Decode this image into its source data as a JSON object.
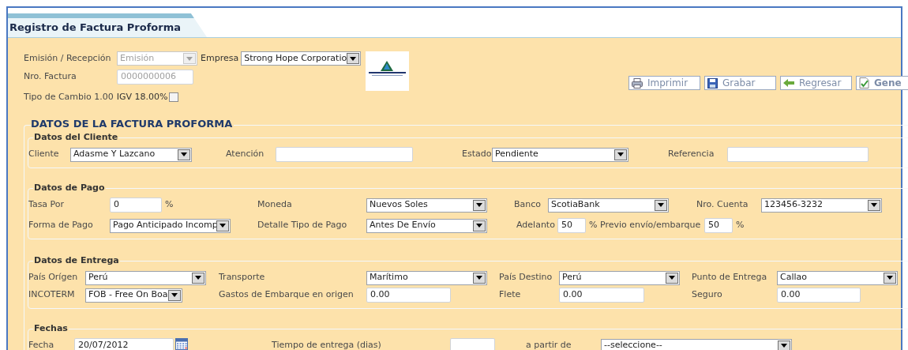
{
  "tab": {
    "title": "Registro de Factura Proforma"
  },
  "header": {
    "emision": {
      "label": "Emisión / Recepción",
      "value": "Emisión",
      "disabled": true
    },
    "empresa": {
      "label": "Empresa",
      "value": "Strong Hope Corporatio",
      "disabled": false
    },
    "nro_factura": {
      "label": "Nro. Factura",
      "value": "0000000006",
      "disabled": true
    },
    "tipo_cambio": "Tipo de Cambio 1.00",
    "igv": {
      "label": "IGV 18.00%",
      "checked": false
    }
  },
  "buttons": [
    {
      "kind": "print",
      "label": "Imprimir",
      "bold": false
    },
    {
      "kind": "save",
      "label": "Grabar",
      "bold": false
    },
    {
      "kind": "back",
      "label": "Regresar",
      "bold": false
    },
    {
      "kind": "generate",
      "label": "Gene",
      "bold": true
    }
  ],
  "form": {
    "title": "DATOS DE LA FACTURA PROFORMA",
    "sections": [
      {
        "title": "Datos del Cliente",
        "rows": [
          [
            {
              "kind": "label",
              "text": "Cliente"
            },
            {
              "kind": "select",
              "value": "Adasme Y Lazcano"
            },
            {
              "kind": "label",
              "text": "Atención"
            },
            {
              "kind": "input"
            },
            {
              "kind": "label",
              "text": "Estado"
            },
            {
              "kind": "select",
              "value": "Pendiente"
            },
            {
              "kind": "label",
              "text": "Referencia"
            },
            {
              "kind": "input"
            }
          ]
        ]
      },
      {
        "title": "Datos de Pago",
        "rows": [
          [
            {
              "kind": "label",
              "text": "Tasa Por"
            },
            {
              "kind": "input",
              "value": "0",
              "unit": "%"
            },
            {
              "kind": "label",
              "text": "Moneda"
            },
            {
              "kind": "select",
              "value": "Nuevos Soles"
            },
            {
              "kind": "label",
              "text": "Banco"
            },
            {
              "kind": "select",
              "value": "ScotiaBank"
            },
            {
              "kind": "label",
              "text": "Nro. Cuenta"
            },
            {
              "kind": "select",
              "value": "123456-3232"
            }
          ],
          [
            {
              "kind": "label",
              "text": "Forma de Pago"
            },
            {
              "kind": "select",
              "value": "Pago Anticipado Incomp"
            },
            {
              "kind": "label",
              "text": "Detalle Tipo de Pago"
            },
            {
              "kind": "select",
              "value": "Antes De Envío"
            },
            {
              "kind": "label",
              "text": "Adelanto"
            },
            {
              "kind": "input",
              "value": "50",
              "unit": "% Previo envío/embarque"
            },
            {
              "kind": "input",
              "value": "50",
              "unit": "%"
            }
          ]
        ]
      },
      {
        "title": "Datos de Entrega",
        "rows": [
          [
            {
              "kind": "label",
              "text": "País Orígen"
            },
            {
              "kind": "select",
              "value": "Perú"
            },
            {
              "kind": "label",
              "text": "Transporte"
            },
            {
              "kind": "select",
              "value": "Marítimo"
            },
            {
              "kind": "label",
              "text": "País Destino"
            },
            {
              "kind": "select",
              "value": "Perú"
            },
            {
              "kind": "label",
              "text": "Punto de Entrega"
            },
            {
              "kind": "select",
              "value": "Callao"
            }
          ],
          [
            {
              "kind": "label",
              "text": "INCOTERM"
            },
            {
              "kind": "select",
              "value": "FOB - Free On Boa"
            },
            {
              "kind": "label",
              "text": "Gastos de Embarque en origen"
            },
            {
              "kind": "input",
              "value": "0.00"
            },
            {
              "kind": "label",
              "text": "Flete"
            },
            {
              "kind": "input",
              "value": "0.00"
            },
            {
              "kind": "label",
              "text": "Seguro"
            },
            {
              "kind": "input",
              "value": "0.00"
            }
          ]
        ]
      },
      {
        "title": "Fechas",
        "rows": [
          [
            {
              "kind": "label",
              "text": "Fecha"
            },
            {
              "kind": "date",
              "value": "20/07/2012"
            },
            {
              "kind": "label",
              "text": "Tiempo de entrega (dias)"
            },
            {
              "kind": "input"
            },
            {
              "kind": "label",
              "text": "a partir de"
            },
            {
              "kind": "select",
              "value": "--seleccione--"
            }
          ]
        ]
      }
    ]
  }
}
